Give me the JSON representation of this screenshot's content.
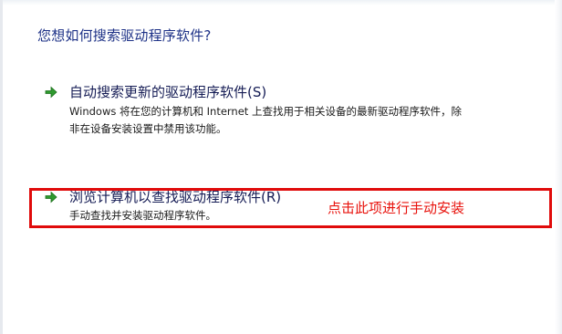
{
  "dialog": {
    "heading": "您想如何搜索驱动程序软件?"
  },
  "options": [
    {
      "title": "自动搜索更新的驱动程序软件(S)",
      "description": "Windows 将在您的计算机和 Internet 上查找用于相关设备的最新驱动程序软件，除非在设备安装设置中禁用该功能。"
    },
    {
      "title": "浏览计算机以查找驱动程序软件(R)",
      "description": "手动查找并安装驱动程序软件。"
    }
  ],
  "annotation": {
    "text": "点击此项进行手动安装",
    "color": "#e00b0b"
  },
  "colors": {
    "heading": "#1e3287",
    "option_title": "#151c55",
    "arrow": "#2e9a2e"
  },
  "icons": {
    "option_arrow": "green-arrow-icon"
  }
}
